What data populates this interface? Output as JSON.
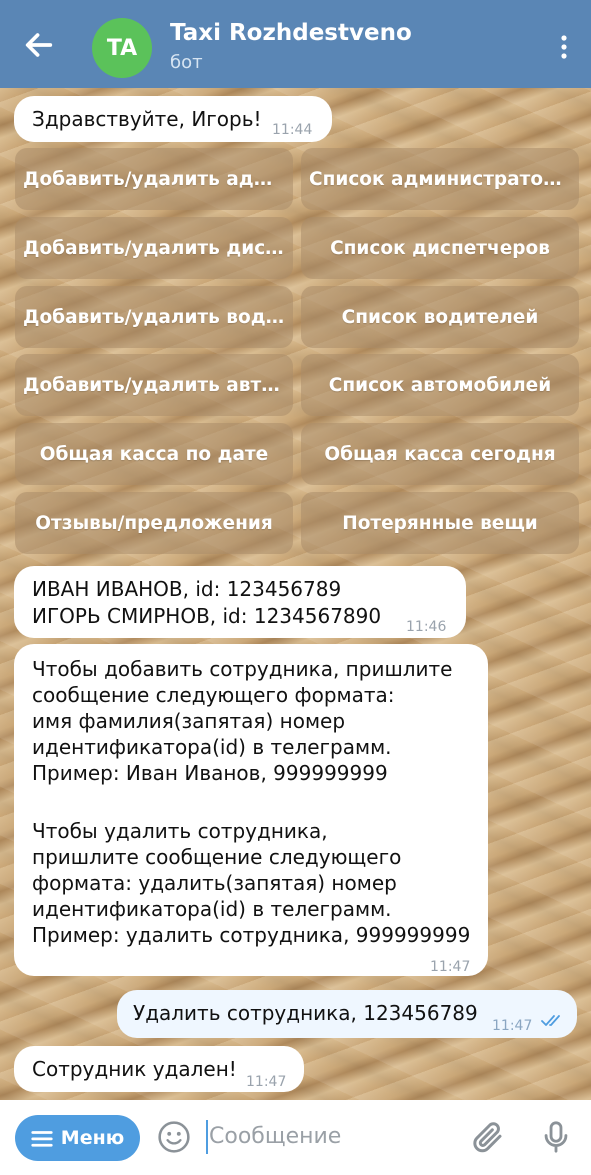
{
  "header": {
    "avatar_initials": "TA",
    "title": "Taxi Rozhdestveno",
    "subtitle": "бот",
    "back_icon": "arrow-left-icon",
    "menu_icon": "more-vertical-icon",
    "avatar_color": "#5bc25a",
    "bar_color": "#5a86b5"
  },
  "messages": [
    {
      "text": "Здравствуйте, Игорь!",
      "time": "11:44"
    },
    {
      "line1": "ИВАН ИВАНОВ, id: 123456789",
      "line2": "ИГОРЬ СМИРНОВ, id: 1234567890",
      "time": "11:46"
    },
    {
      "p1": [
        "Чтобы добавить сотрудника, пришлите",
        "сообщение следующего формата:",
        "имя фамилия(запятая) номер",
        "идентификатора(id) в телеграмм.",
        "Пример: Иван Иванов, 999999999"
      ],
      "p2": [
        "Чтобы удалить сотрудника,",
        "пришлите сообщение следующего",
        "формата: удалить(запятая) номер",
        "идентификатора(id) в телеграмм.",
        "Пример: удалить сотрудника, 999999999"
      ],
      "time": "11:47"
    },
    {
      "text": "Удалить сотрудника, 123456789",
      "time": "11:47",
      "status_icon": "double-check-icon"
    },
    {
      "text": "Сотрудник удален!",
      "time": "11:47"
    }
  ],
  "keyboard": [
    [
      "Добавить/удалить администратора",
      "Список администраторов"
    ],
    [
      "Добавить/удалить диспетчера",
      "Список диспетчеров"
    ],
    [
      "Добавить/удалить водителя",
      "Список водителей"
    ],
    [
      "Добавить/удалить автомобиль",
      "Список автомобилей"
    ],
    [
      "Общая касса по дате",
      "Общая касса сегодня"
    ],
    [
      "Отзывы/предложения",
      "Потерянные вещи"
    ]
  ],
  "input": {
    "menu_label": "Меню",
    "placeholder": "Сообщение",
    "emoji_icon": "emoji-icon",
    "attach_icon": "paperclip-icon",
    "mic_icon": "microphone-icon",
    "accent": "#4f9de0"
  }
}
